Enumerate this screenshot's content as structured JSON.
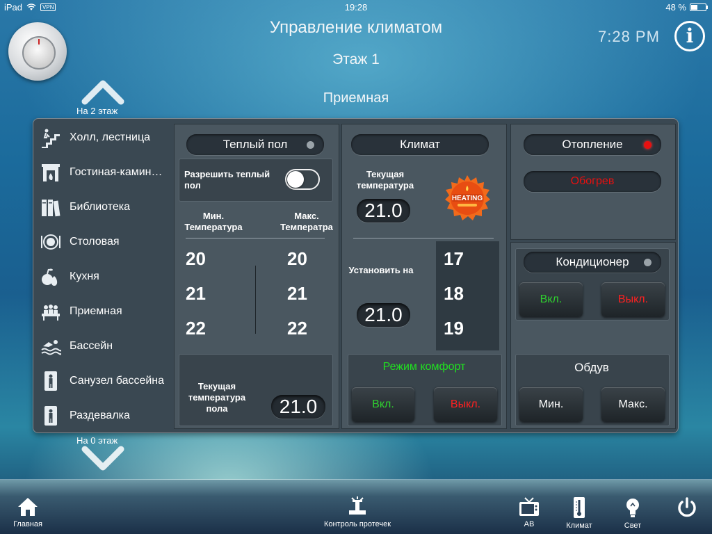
{
  "status_bar": {
    "device": "iPad",
    "vpn": "VPN",
    "time": "19:28",
    "battery": "48 %"
  },
  "header": {
    "title": "Управление климатом",
    "floor": "Этаж 1",
    "room": "Приемная",
    "clock": "7:28 PM",
    "info_icon": "i"
  },
  "floor_nav": {
    "up_label": "На 2 этаж",
    "down_label": "На 0 этаж"
  },
  "rooms": [
    {
      "label": "Холл, лестница",
      "icon": "stairs-icon"
    },
    {
      "label": "Гостиная-камин…",
      "icon": "fireplace-icon"
    },
    {
      "label": "Библиотека",
      "icon": "books-icon"
    },
    {
      "label": "Столовая",
      "icon": "dining-plate-icon"
    },
    {
      "label": "Кухня",
      "icon": "fruit-icon"
    },
    {
      "label": "Приемная",
      "icon": "meeting-icon"
    },
    {
      "label": "Бассейн",
      "icon": "swimmer-icon"
    },
    {
      "label": "Санузел бассейна",
      "icon": "toilet-person-icon"
    },
    {
      "label": "Раздевалка",
      "icon": "toilet-person-icon"
    }
  ],
  "warm_floor": {
    "title": "Теплый пол",
    "enable_label": "Разрешить теплый пол",
    "enable_state": "off",
    "min_header": "Мин. Температура",
    "max_header": "Макс. Температра",
    "min_values": [
      "20",
      "21",
      "22"
    ],
    "max_values": [
      "20",
      "21",
      "22"
    ],
    "floor_temp_label": "Текущая температура пола",
    "floor_temp_value": "21.0"
  },
  "climate": {
    "title": "Климат",
    "current_label": "Текущая температура",
    "current_value": "21.0",
    "badge": "HEATING",
    "set_label": "Установить на",
    "set_value": "21.0",
    "set_options": [
      "17",
      "18",
      "19"
    ],
    "comfort_label": "Режим комфорт",
    "on_label": "Вкл.",
    "off_label": "Выкл."
  },
  "heating": {
    "title": "Отопление",
    "status": "Обогрев",
    "indicator_color": "#e81010"
  },
  "conditioner": {
    "title": "Кондиционер",
    "on_label": "Вкл.",
    "off_label": "Выкл."
  },
  "blow": {
    "title": "Обдув",
    "min_label": "Мин.",
    "max_label": "Макс."
  },
  "bottom_nav": [
    {
      "label": "Главная",
      "icon": "home-icon"
    },
    {
      "label": "Контроль протечек",
      "icon": "leak-valve-icon"
    },
    {
      "label": "AB",
      "icon": "tv-icon"
    },
    {
      "label": "Климат",
      "icon": "thermometer-icon"
    },
    {
      "label": "Свет",
      "icon": "lightbulb-icon"
    },
    {
      "label": "",
      "icon": "power-icon"
    }
  ],
  "colors": {
    "on_green": "#2fd02f",
    "off_red": "#ff2020",
    "comfort_green": "#20e020"
  }
}
